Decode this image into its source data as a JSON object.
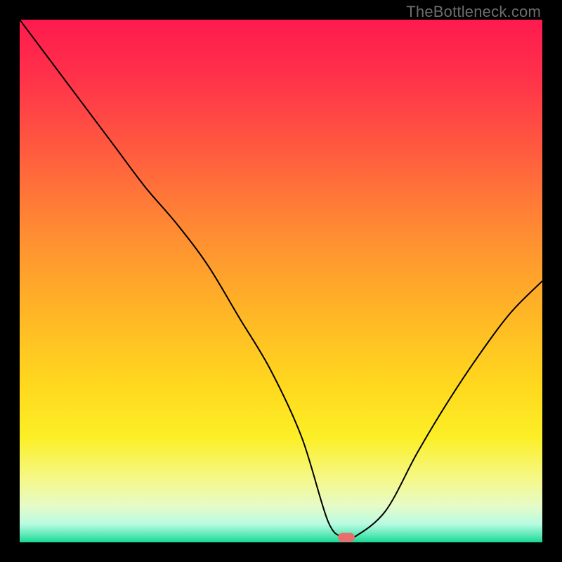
{
  "attribution": "TheBottleneck.com",
  "chart_data": {
    "type": "line",
    "title": "",
    "xlabel": "",
    "ylabel": "",
    "xlim": [
      0,
      1
    ],
    "ylim": [
      0,
      1
    ],
    "x": [
      0.0,
      0.06,
      0.12,
      0.18,
      0.24,
      0.3,
      0.36,
      0.42,
      0.48,
      0.54,
      0.59,
      0.62,
      0.64,
      0.7,
      0.76,
      0.82,
      0.88,
      0.94,
      1.0
    ],
    "y": [
      1.0,
      0.92,
      0.84,
      0.76,
      0.68,
      0.61,
      0.53,
      0.43,
      0.33,
      0.2,
      0.04,
      0.01,
      0.01,
      0.06,
      0.17,
      0.27,
      0.36,
      0.44,
      0.5
    ],
    "gradient_stops": [
      {
        "pos": 0.0,
        "color": "#ff1a4e"
      },
      {
        "pos": 0.12,
        "color": "#ff3449"
      },
      {
        "pos": 0.25,
        "color": "#ff5b3f"
      },
      {
        "pos": 0.4,
        "color": "#ff8a33"
      },
      {
        "pos": 0.55,
        "color": "#ffb327"
      },
      {
        "pos": 0.7,
        "color": "#ffd81e"
      },
      {
        "pos": 0.8,
        "color": "#fcef27"
      },
      {
        "pos": 0.88,
        "color": "#f5f88a"
      },
      {
        "pos": 0.93,
        "color": "#e6fbc7"
      },
      {
        "pos": 0.965,
        "color": "#b8fbe2"
      },
      {
        "pos": 0.985,
        "color": "#5feab8"
      },
      {
        "pos": 1.0,
        "color": "#17d892"
      }
    ],
    "marker": {
      "x": 0.625,
      "y": 0.01,
      "color": "#e86e6e"
    }
  }
}
